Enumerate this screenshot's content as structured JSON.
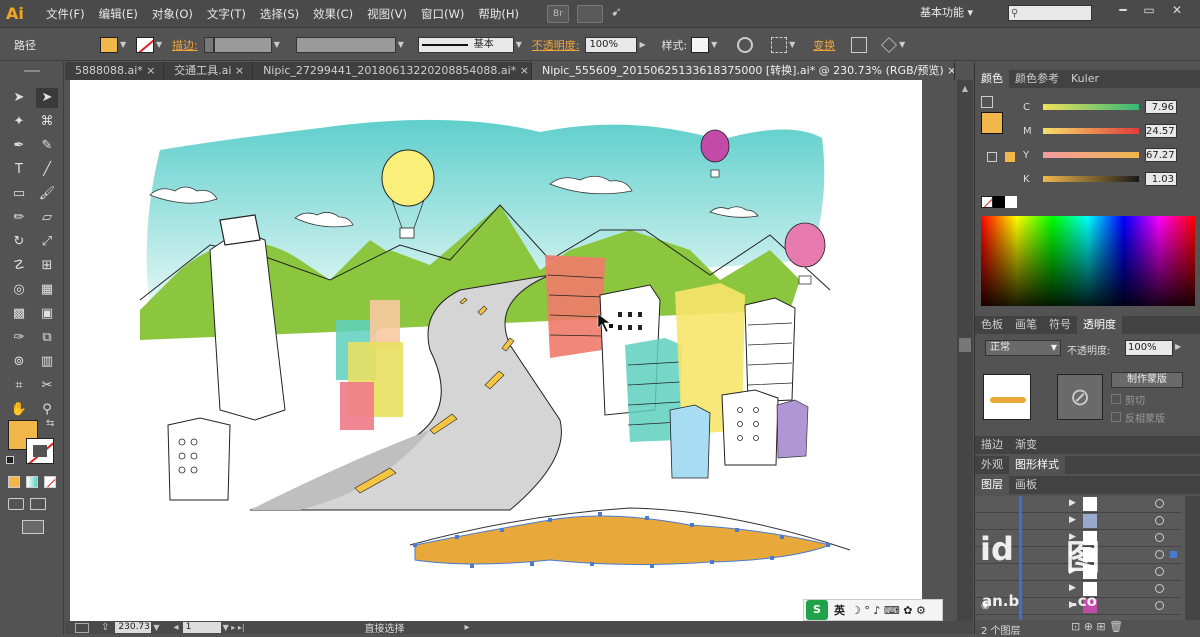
{
  "app": {
    "logo": "Ai"
  },
  "menu": [
    "文件(F)",
    "编辑(E)",
    "对象(O)",
    "文字(T)",
    "选择(S)",
    "效果(C)",
    "视图(V)",
    "窗口(W)",
    "帮助(H)"
  ],
  "menubar_right": {
    "br_icon": "Br",
    "workspace": "基本功能"
  },
  "window_buttons": {
    "minimize": "━",
    "restore": "▭",
    "close": "✕"
  },
  "controlbar": {
    "label": "路径",
    "fill_color": "#f1b74a",
    "stroke_label": "描边:",
    "stroke_style": "基本",
    "opacity_label": "不透明度:",
    "opacity_value": "100%",
    "style_label": "样式:",
    "transform_label": "变换"
  },
  "tabs": [
    {
      "label": "5888088.ai*",
      "close": "×",
      "active": false
    },
    {
      "label": "交通工具.ai",
      "close": "×",
      "active": false
    },
    {
      "label": "Nipic_27299441_20180613220208854088.ai*",
      "close": "×",
      "active": false
    },
    {
      "label": "Nipic_555609_20150625133618375000 [转换].ai* @ 230.73% (RGB/预览)",
      "close": "×",
      "active": true
    }
  ],
  "tools": {
    "type_tool": "T",
    "swap_icon": "⇆",
    "fill_color": "#f1b74a"
  },
  "status": {
    "zoom": "230.73",
    "page": "1",
    "tool": "直接选择"
  },
  "color_panel": {
    "tabs": [
      "颜色",
      "颜色参考",
      "Kuler"
    ],
    "fill_swatch": "#f1b74a",
    "channels": [
      {
        "letter": "C",
        "value": "7.96",
        "pos": 0.08
      },
      {
        "letter": "M",
        "value": "24.57",
        "pos": 0.25
      },
      {
        "letter": "Y",
        "value": "67.27",
        "pos": 0.67
      },
      {
        "letter": "K",
        "value": "1.03",
        "pos": 0.01
      }
    ]
  },
  "transparency_panel": {
    "tabs": [
      "色板",
      "画笔",
      "符号",
      "透明度"
    ],
    "blend_mode": "正常",
    "opacity_label": "不透明度:",
    "opacity_value": "100%",
    "make_mask_button": "制作蒙版",
    "clip_label": "剪切",
    "invert_label": "反相蒙版"
  },
  "stroke_tabs": [
    "描边",
    "渐变"
  ],
  "appearance_tabs": [
    "外观",
    "图形样式"
  ],
  "layers_panel": {
    "tabs": [
      "图层",
      "画板"
    ],
    "footer": "2 个图层"
  },
  "watermark": {
    "line1": "id",
    "line2": "an.b",
    "line3": "图",
    "line4": ".co"
  },
  "ime": {
    "logo": "S",
    "lang": "英",
    "symbols": "☽ ° ♪ ⌨ ✿ ⚙"
  },
  "colors": {
    "accent": "#f0a63a",
    "sky": "#7fd6d6",
    "mountain": "#8cc63f",
    "road": "#cfcfcf",
    "lane": "#f5c542",
    "tower_red": "#f07a6a",
    "tower_yellow": "#f7e46a",
    "tower_teal": "#5ed0c0",
    "tower_purple": "#a98bd0",
    "balloon_yellow": "#f9ef7a",
    "balloon_pink": "#e77bb0",
    "balloon_magenta": "#c24aa8",
    "shape_orange": "#e8a93a"
  }
}
